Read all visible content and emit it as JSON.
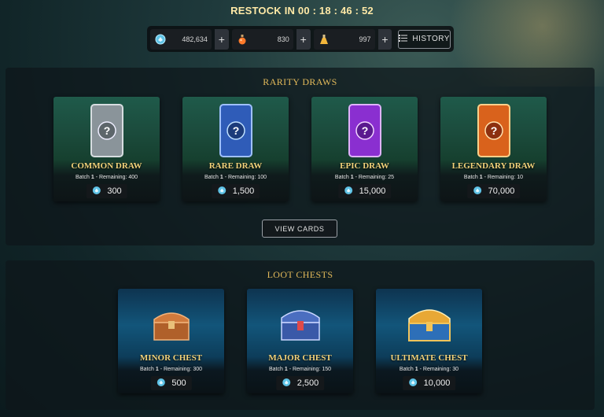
{
  "restock": {
    "label": "RESTOCK IN",
    "timer": "00 : 18 : 46 : 52"
  },
  "currencies": [
    {
      "icon": "gem-icon",
      "value": "482,634",
      "color": "#5fc3e6"
    },
    {
      "icon": "potion-icon",
      "value": "830",
      "color": "#ff7a2a"
    },
    {
      "icon": "flask-icon",
      "value": "997",
      "color": "#f2b63b"
    }
  ],
  "history_label": "HISTORY",
  "rarity_section": {
    "title": "RARITY DRAWS",
    "items": [
      {
        "name": "COMMON DRAW",
        "batch_label": "Batch",
        "batch": "1",
        "remaining_label": "- Remaining:",
        "remaining": "400",
        "price": "300",
        "color": "#9ba3a8"
      },
      {
        "name": "RARE DRAW",
        "batch_label": "Batch",
        "batch": "1",
        "remaining_label": "- Remaining:",
        "remaining": "100",
        "price": "1,500",
        "color": "#3f7ad8"
      },
      {
        "name": "EPIC DRAW",
        "batch_label": "Batch",
        "batch": "1",
        "remaining_label": "- Remaining:",
        "remaining": "25",
        "price": "15,000",
        "color": "#a13ee0"
      },
      {
        "name": "LEGENDARY DRAW",
        "batch_label": "Batch",
        "batch": "1",
        "remaining_label": "- Remaining:",
        "remaining": "10",
        "price": "70,000",
        "color": "#e26b1e"
      }
    ],
    "view_cards_label": "VIEW CARDS"
  },
  "chest_section": {
    "title": "LOOT CHESTS",
    "items": [
      {
        "name": "MINOR CHEST",
        "batch_label": "Batch",
        "batch": "1",
        "remaining_label": "- Remaining:",
        "remaining": "300",
        "price": "500",
        "color": "#c0703a"
      },
      {
        "name": "MAJOR CHEST",
        "batch_label": "Batch",
        "batch": "1",
        "remaining_label": "- Remaining:",
        "remaining": "150",
        "price": "2,500",
        "color": "#4b6ec0"
      },
      {
        "name": "ULTIMATE CHEST",
        "batch_label": "Batch",
        "batch": "1",
        "remaining_label": "- Remaining:",
        "remaining": "30",
        "price": "10,000",
        "color": "#e8a835"
      }
    ]
  }
}
